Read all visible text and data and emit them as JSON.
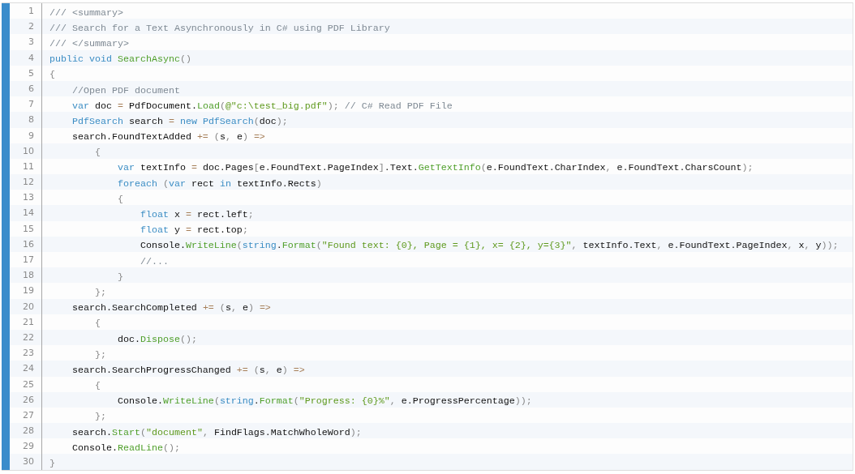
{
  "code_lines": [
    {
      "number": "1",
      "tokens": [
        {
          "kind": "comment",
          "text": "/// <summary>"
        }
      ]
    },
    {
      "number": "2",
      "tokens": [
        {
          "kind": "comment",
          "text": "/// Search for a Text Asynchronously in C# using PDF Library"
        }
      ]
    },
    {
      "number": "3",
      "tokens": [
        {
          "kind": "comment",
          "text": "/// </summary>"
        }
      ]
    },
    {
      "number": "4",
      "tokens": [
        {
          "kind": "keyword",
          "text": "public void "
        },
        {
          "kind": "method",
          "text": "SearchAsync"
        },
        {
          "kind": "punct",
          "text": "()"
        }
      ]
    },
    {
      "number": "5",
      "tokens": [
        {
          "kind": "punct",
          "text": "{"
        }
      ]
    },
    {
      "number": "6",
      "tokens": [
        {
          "kind": "comment",
          "text": "    //Open PDF document"
        }
      ]
    },
    {
      "number": "7",
      "tokens": [
        {
          "kind": "keyword",
          "text": "    var"
        },
        {
          "kind": "plain",
          "text": " doc "
        },
        {
          "kind": "operator",
          "text": "="
        },
        {
          "kind": "plain",
          "text": " PdfDocument."
        },
        {
          "kind": "method",
          "text": "Load"
        },
        {
          "kind": "punct",
          "text": "("
        },
        {
          "kind": "string",
          "text": "@\"c:\\test_big.pdf\""
        },
        {
          "kind": "punct",
          "text": ");"
        },
        {
          "kind": "comment",
          "text": " // C# Read PDF File"
        }
      ]
    },
    {
      "number": "8",
      "tokens": [
        {
          "kind": "keyword",
          "text": "    PdfSearch"
        },
        {
          "kind": "plain",
          "text": " search "
        },
        {
          "kind": "operator",
          "text": "="
        },
        {
          "kind": "keyword",
          "text": " new PdfSearch"
        },
        {
          "kind": "punct",
          "text": "("
        },
        {
          "kind": "plain",
          "text": "doc"
        },
        {
          "kind": "punct",
          "text": ");"
        }
      ]
    },
    {
      "number": "9",
      "tokens": [
        {
          "kind": "plain",
          "text": "    search.FoundTextAdded "
        },
        {
          "kind": "operator",
          "text": "+="
        },
        {
          "kind": "punct",
          "text": " ("
        },
        {
          "kind": "plain",
          "text": "s"
        },
        {
          "kind": "punct",
          "text": ", "
        },
        {
          "kind": "plain",
          "text": "e"
        },
        {
          "kind": "punct",
          "text": ") "
        },
        {
          "kind": "operator",
          "text": "=>"
        }
      ]
    },
    {
      "number": "10",
      "tokens": [
        {
          "kind": "punct",
          "text": "        {"
        }
      ]
    },
    {
      "number": "11",
      "tokens": [
        {
          "kind": "keyword",
          "text": "            var"
        },
        {
          "kind": "plain",
          "text": " textInfo "
        },
        {
          "kind": "operator",
          "text": "="
        },
        {
          "kind": "plain",
          "text": " doc.Pages"
        },
        {
          "kind": "punct",
          "text": "["
        },
        {
          "kind": "plain",
          "text": "e.FoundText.PageIndex"
        },
        {
          "kind": "punct",
          "text": "]"
        },
        {
          "kind": "plain",
          "text": ".Text."
        },
        {
          "kind": "method",
          "text": "GetTextInfo"
        },
        {
          "kind": "punct",
          "text": "("
        },
        {
          "kind": "plain",
          "text": "e.FoundText.CharIndex"
        },
        {
          "kind": "punct",
          "text": ", "
        },
        {
          "kind": "plain",
          "text": "e.FoundText.CharsCount"
        },
        {
          "kind": "punct",
          "text": ");"
        }
      ]
    },
    {
      "number": "12",
      "tokens": [
        {
          "kind": "keyword",
          "text": "            foreach"
        },
        {
          "kind": "punct",
          "text": " ("
        },
        {
          "kind": "keyword",
          "text": "var"
        },
        {
          "kind": "plain",
          "text": " rect "
        },
        {
          "kind": "keyword",
          "text": "in"
        },
        {
          "kind": "plain",
          "text": " textInfo.Rects"
        },
        {
          "kind": "punct",
          "text": ")"
        }
      ]
    },
    {
      "number": "13",
      "tokens": [
        {
          "kind": "punct",
          "text": "            {"
        }
      ]
    },
    {
      "number": "14",
      "tokens": [
        {
          "kind": "keyword",
          "text": "                float"
        },
        {
          "kind": "plain",
          "text": " x "
        },
        {
          "kind": "operator",
          "text": "="
        },
        {
          "kind": "plain",
          "text": " rect.left"
        },
        {
          "kind": "punct",
          "text": ";"
        }
      ]
    },
    {
      "number": "15",
      "tokens": [
        {
          "kind": "keyword",
          "text": "                float"
        },
        {
          "kind": "plain",
          "text": " y "
        },
        {
          "kind": "operator",
          "text": "="
        },
        {
          "kind": "plain",
          "text": " rect.top"
        },
        {
          "kind": "punct",
          "text": ";"
        }
      ]
    },
    {
      "number": "16",
      "tokens": [
        {
          "kind": "plain",
          "text": "                Console."
        },
        {
          "kind": "method",
          "text": "WriteLine"
        },
        {
          "kind": "punct",
          "text": "("
        },
        {
          "kind": "keyword",
          "text": "string"
        },
        {
          "kind": "plain",
          "text": "."
        },
        {
          "kind": "method",
          "text": "Format"
        },
        {
          "kind": "punct",
          "text": "("
        },
        {
          "kind": "string",
          "text": "\"Found text: {0}, Page = {1}, x= {2}, y={3}\""
        },
        {
          "kind": "punct",
          "text": ", "
        },
        {
          "kind": "plain",
          "text": "textInfo.Text"
        },
        {
          "kind": "punct",
          "text": ", "
        },
        {
          "kind": "plain",
          "text": "e.FoundText.PageIndex"
        },
        {
          "kind": "punct",
          "text": ", "
        },
        {
          "kind": "plain",
          "text": "x"
        },
        {
          "kind": "punct",
          "text": ", "
        },
        {
          "kind": "plain",
          "text": "y"
        },
        {
          "kind": "punct",
          "text": "));"
        }
      ]
    },
    {
      "number": "17",
      "tokens": [
        {
          "kind": "comment",
          "text": "                //..."
        }
      ]
    },
    {
      "number": "18",
      "tokens": [
        {
          "kind": "punct",
          "text": "            }"
        }
      ]
    },
    {
      "number": "19",
      "tokens": [
        {
          "kind": "punct",
          "text": "        };"
        }
      ]
    },
    {
      "number": "20",
      "tokens": [
        {
          "kind": "plain",
          "text": "    search.SearchCompleted "
        },
        {
          "kind": "operator",
          "text": "+="
        },
        {
          "kind": "punct",
          "text": " ("
        },
        {
          "kind": "plain",
          "text": "s"
        },
        {
          "kind": "punct",
          "text": ", "
        },
        {
          "kind": "plain",
          "text": "e"
        },
        {
          "kind": "punct",
          "text": ") "
        },
        {
          "kind": "operator",
          "text": "=>"
        }
      ]
    },
    {
      "number": "21",
      "tokens": [
        {
          "kind": "punct",
          "text": "        {"
        }
      ]
    },
    {
      "number": "22",
      "tokens": [
        {
          "kind": "plain",
          "text": "            doc."
        },
        {
          "kind": "method",
          "text": "Dispose"
        },
        {
          "kind": "punct",
          "text": "();"
        }
      ]
    },
    {
      "number": "23",
      "tokens": [
        {
          "kind": "punct",
          "text": "        };"
        }
      ]
    },
    {
      "number": "24",
      "tokens": [
        {
          "kind": "plain",
          "text": "    search.SearchProgressChanged "
        },
        {
          "kind": "operator",
          "text": "+="
        },
        {
          "kind": "punct",
          "text": " ("
        },
        {
          "kind": "plain",
          "text": "s"
        },
        {
          "kind": "punct",
          "text": ", "
        },
        {
          "kind": "plain",
          "text": "e"
        },
        {
          "kind": "punct",
          "text": ") "
        },
        {
          "kind": "operator",
          "text": "=>"
        }
      ]
    },
    {
      "number": "25",
      "tokens": [
        {
          "kind": "punct",
          "text": "        {"
        }
      ]
    },
    {
      "number": "26",
      "tokens": [
        {
          "kind": "plain",
          "text": "            Console."
        },
        {
          "kind": "method",
          "text": "WriteLine"
        },
        {
          "kind": "punct",
          "text": "("
        },
        {
          "kind": "keyword",
          "text": "string"
        },
        {
          "kind": "plain",
          "text": "."
        },
        {
          "kind": "method",
          "text": "Format"
        },
        {
          "kind": "punct",
          "text": "("
        },
        {
          "kind": "string",
          "text": "\"Progress: {0}%\""
        },
        {
          "kind": "punct",
          "text": ", "
        },
        {
          "kind": "plain",
          "text": "e.ProgressPercentage"
        },
        {
          "kind": "punct",
          "text": "));"
        }
      ]
    },
    {
      "number": "27",
      "tokens": [
        {
          "kind": "punct",
          "text": "        };"
        }
      ]
    },
    {
      "number": "28",
      "tokens": [
        {
          "kind": "plain",
          "text": "    search."
        },
        {
          "kind": "method",
          "text": "Start"
        },
        {
          "kind": "punct",
          "text": "("
        },
        {
          "kind": "string",
          "text": "\"document\""
        },
        {
          "kind": "punct",
          "text": ", "
        },
        {
          "kind": "plain",
          "text": "FindFlags.MatchWholeWord"
        },
        {
          "kind": "punct",
          "text": ");"
        }
      ]
    },
    {
      "number": "29",
      "tokens": [
        {
          "kind": "plain",
          "text": "    Console."
        },
        {
          "kind": "method",
          "text": "ReadLine"
        },
        {
          "kind": "punct",
          "text": "();"
        }
      ]
    },
    {
      "number": "30",
      "tokens": [
        {
          "kind": "punct",
          "text": "}"
        }
      ]
    }
  ]
}
